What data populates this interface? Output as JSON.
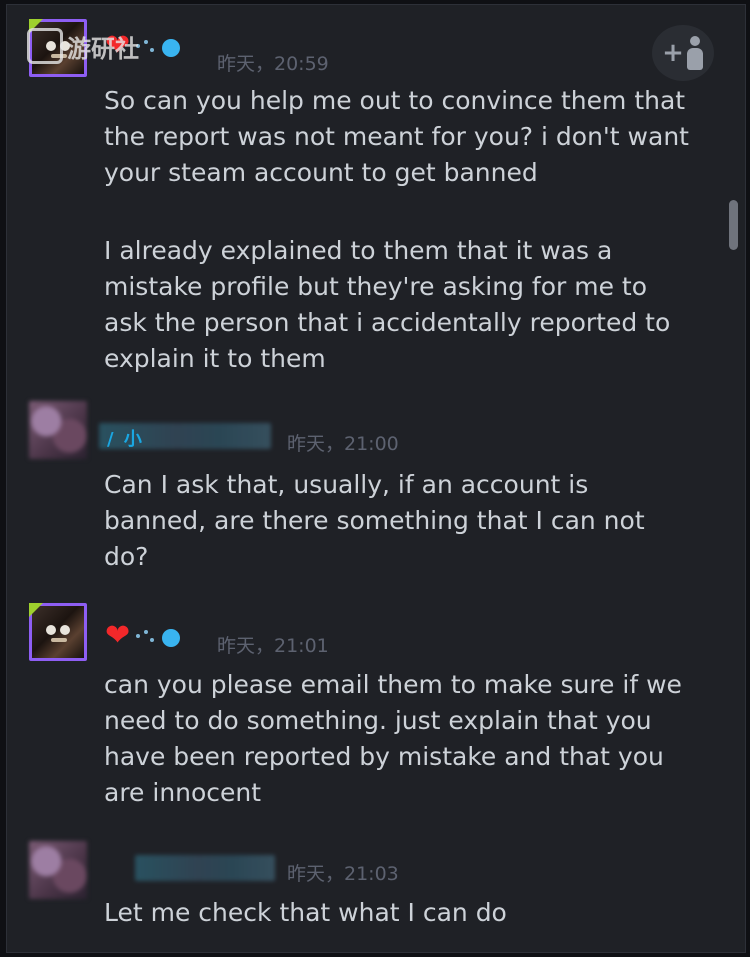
{
  "messages": [
    {
      "sender": "steam",
      "timestamp": "昨天，20:59",
      "lines": [
        "So can you help me out to convince them that the report was not meant for you? i don't want your steam account to get banned",
        "I already explained to them that it was a mistake profile but they're asking for me to ask the person that i accidentally reported to explain it to them"
      ]
    },
    {
      "sender": "user",
      "name_fragment": "/ 小",
      "timestamp": "昨天，21:00",
      "lines": [
        "Can I ask that, usually, if an account is banned, are there something that I can not do?"
      ]
    },
    {
      "sender": "steam",
      "timestamp": "昨天，21:01",
      "lines": [
        "can you please email them to make sure if we need to do something. just explain that you have been reported by mistake and that you are innocent"
      ]
    },
    {
      "sender": "user",
      "timestamp": "昨天，21:03",
      "lines": [
        "Let me check that what I can do"
      ]
    }
  ],
  "watermark": {
    "text": "游研社"
  },
  "icons": {
    "persona": "heart-icon",
    "add_friend": "add-friend-icon"
  },
  "colors": {
    "background": "#1f2126",
    "text": "#cdd2d8",
    "timestamp": "#5d6270",
    "heart": "#f3282a",
    "avatar_border": "#8e5ef3"
  }
}
